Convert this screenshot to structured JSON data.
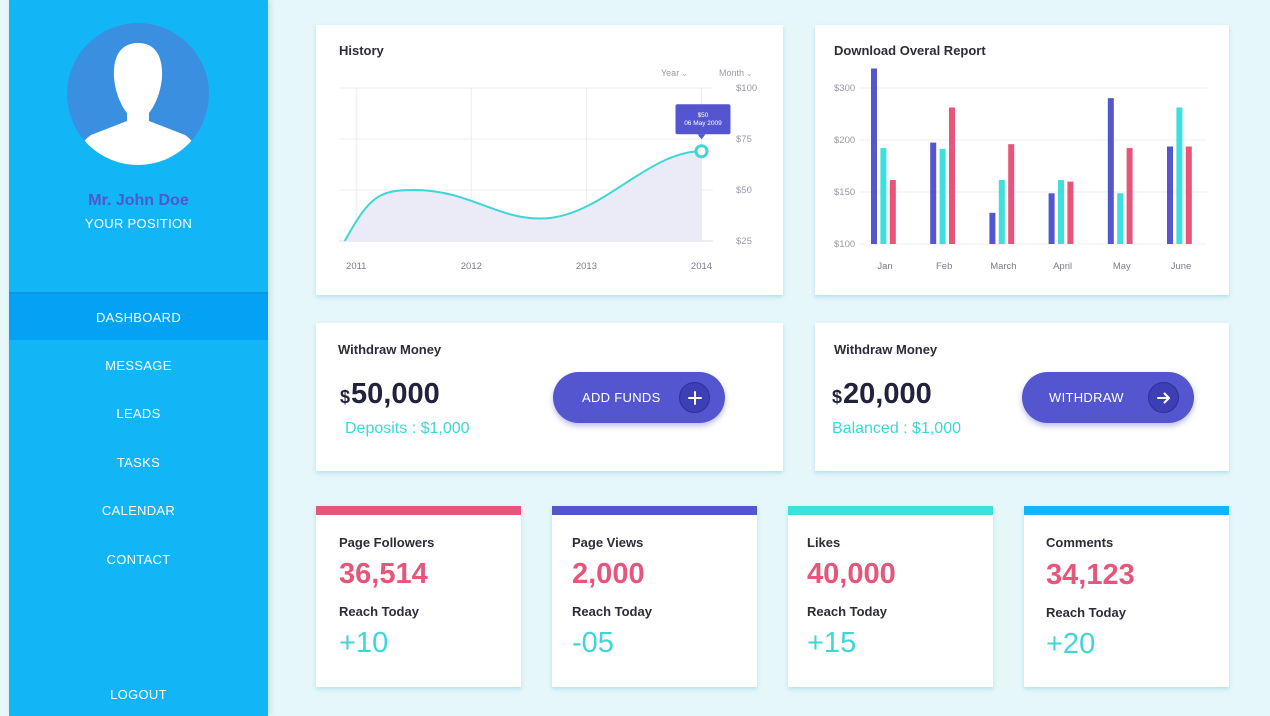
{
  "sidebar": {
    "user_name": "Mr. John Doe",
    "user_position": "YOUR POSITION",
    "nav": [
      {
        "label": "DASHBOARD",
        "active": true
      },
      {
        "label": "MESSAGE",
        "active": false
      },
      {
        "label": "LEADS",
        "active": false
      },
      {
        "label": "TASKS",
        "active": false
      },
      {
        "label": "CALENDAR",
        "active": false
      },
      {
        "label": "CONTACT",
        "active": false
      }
    ],
    "logout_label": "LOGOUT"
  },
  "history": {
    "title": "History",
    "filter_year": "Year",
    "filter_month": "Month",
    "tooltip_value": "$50",
    "tooltip_date": "06 May 2009"
  },
  "report": {
    "title": "Download Overal Report"
  },
  "withdraw_left": {
    "title": "Withdraw Money",
    "currency": "$",
    "amount": "50,000",
    "sub": "Deposits : $1,000",
    "button_label": "ADD FUNDS"
  },
  "withdraw_right": {
    "title": "Withdraw Money",
    "currency": "$",
    "amount": "20,000",
    "sub": "Balanced : $1,000",
    "button_label": "WITHDRAW"
  },
  "stats": [
    {
      "title": "Page Followers",
      "value": "36,514",
      "reach_label": "Reach Today",
      "delta": "+10",
      "color": "#e8557a"
    },
    {
      "title": "Page Views",
      "value": "2,000",
      "reach_label": "Reach Today",
      "delta": "-05",
      "color": "#5356cf"
    },
    {
      "title": "Likes",
      "value": "40,000",
      "reach_label": "Reach Today",
      "delta": "+15",
      "color": "#3de0dc"
    },
    {
      "title": "Comments",
      "value": "34,123",
      "reach_label": "Reach Today",
      "delta": "+20",
      "color": "#12b6f6"
    }
  ],
  "colors": {
    "sidebar": "#12b6f6",
    "accent_indigo": "#5356cf",
    "accent_teal": "#3fd6d8",
    "accent_pink": "#e8557a"
  },
  "chart_data": [
    {
      "type": "area",
      "title": "History",
      "x": [
        "2011",
        "2012",
        "2013",
        "2014"
      ],
      "y_ticks": [
        "$100",
        "$75",
        "$50",
        "$25"
      ],
      "ylim": [
        25,
        100
      ],
      "points": [
        {
          "x": 2010.9,
          "y": 25
        },
        {
          "x": 2011.5,
          "y": 50
        },
        {
          "x": 2012.6,
          "y": 36
        },
        {
          "x": 2014.0,
          "y": 69
        }
      ],
      "highlight": {
        "x": 2014.0,
        "y": 69,
        "label": "$50"
      },
      "grid": true
    },
    {
      "type": "bar",
      "title": "Download Overal Report",
      "categories": [
        "Jan",
        "Feb",
        "March",
        "April",
        "May",
        "June"
      ],
      "y_ticks": [
        "$300",
        "$200",
        "$150",
        "$100"
      ],
      "ylim": [
        100,
        300
      ],
      "series": [
        {
          "color": "#5356cf",
          "values": [
            325,
            230,
            140,
            165,
            287,
            225
          ]
        },
        {
          "color": "#3de0dc",
          "values": [
            223,
            222,
            182,
            182,
            165,
            275
          ]
        },
        {
          "color": "#e8557a",
          "values": [
            182,
            275,
            228,
            180,
            223,
            225
          ]
        }
      ],
      "grid": true
    }
  ]
}
